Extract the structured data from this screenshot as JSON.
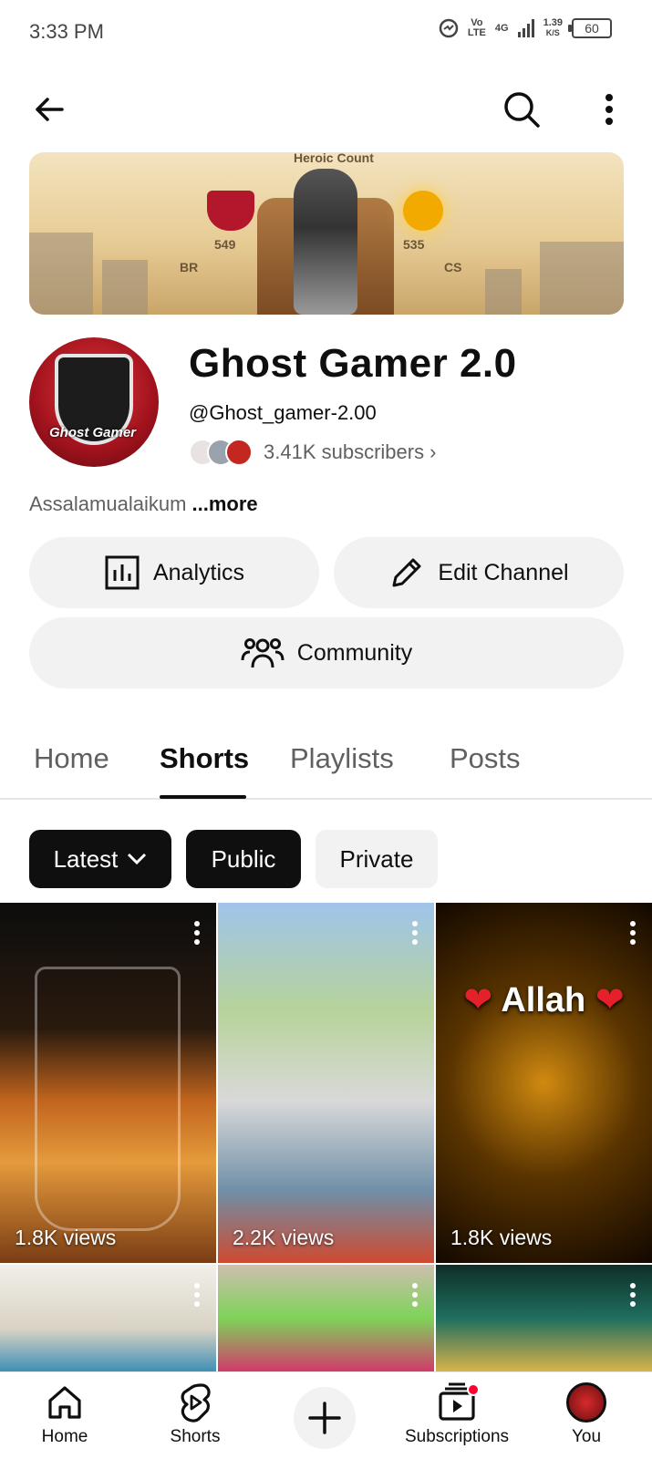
{
  "status_bar": {
    "time": "3:33 PM",
    "network_top": "Vo",
    "network_bottom": "LTE",
    "network_gen": "4G",
    "speed_value": "1.39",
    "speed_unit": "K/S",
    "battery": "60"
  },
  "top_bar": {
    "back_icon": "arrow-left-icon",
    "search_icon": "search-icon",
    "more_icon": "more-vert-icon"
  },
  "banner": {
    "heading": "Heroic Count",
    "left_rank": "BR",
    "left_score": "549",
    "right_rank": "CS",
    "right_score": "535"
  },
  "channel": {
    "avatar_text": "Ghost Gamer",
    "name": "Ghost Gamer 2.0",
    "handle": "@Ghost_gamer-2.00",
    "subscribers": "3.41K subscribers",
    "description": "Assalamualaikum",
    "more_label": "...more"
  },
  "actions": {
    "analytics": "Analytics",
    "edit_channel": "Edit Channel",
    "community": "Community"
  },
  "tabs": [
    {
      "label": "Home",
      "active": false
    },
    {
      "label": "Shorts",
      "active": true
    },
    {
      "label": "Playlists",
      "active": false
    },
    {
      "label": "Posts",
      "active": false
    }
  ],
  "filters": {
    "sort": "Latest",
    "public": "Public",
    "private": "Private"
  },
  "shorts": [
    {
      "views": "1.8K views",
      "overlay_title": ""
    },
    {
      "views": "2.2K views",
      "overlay_title": ""
    },
    {
      "views": "1.8K views",
      "overlay_title": "Allah"
    },
    {
      "views": "",
      "overlay_title": ""
    },
    {
      "views": "",
      "overlay_title": ""
    },
    {
      "views": "",
      "overlay_title": ""
    }
  ],
  "bottom_nav": {
    "home": "Home",
    "shorts": "Shorts",
    "subscriptions": "Subscriptions",
    "you": "You"
  },
  "colors": {
    "accent_red": "#ff0033",
    "chip_active": "#0f0f0f",
    "chip_inactive": "#f2f2f2",
    "secondary_text": "#606060"
  }
}
